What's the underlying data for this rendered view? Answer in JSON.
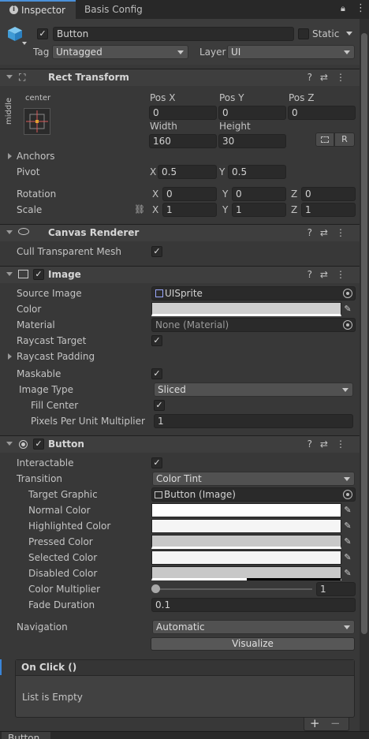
{
  "tabs": {
    "inspector": "Inspector",
    "basis_config": "Basis Config"
  },
  "object": {
    "name": "Button",
    "static_label": "Static",
    "tag_label": "Tag",
    "tag_value": "Untagged",
    "layer_label": "Layer",
    "layer_value": "UI"
  },
  "rect_transform": {
    "title": "Rect Transform",
    "anchor_h": "center",
    "anchor_v": "middle",
    "pos_x_label": "Pos X",
    "pos_y_label": "Pos Y",
    "pos_z_label": "Pos Z",
    "pos_x": "0",
    "pos_y": "0",
    "pos_z": "0",
    "width_label": "Width",
    "height_label": "Height",
    "width": "160",
    "height": "30",
    "r_button": "R",
    "anchors_label": "Anchors",
    "pivot_label": "Pivot",
    "pivot_x": "0.5",
    "pivot_y": "0.5",
    "rotation_label": "Rotation",
    "rot_x": "0",
    "rot_y": "0",
    "rot_z": "0",
    "scale_label": "Scale",
    "scale_x": "1",
    "scale_y": "1",
    "scale_z": "1",
    "axis_x": "X",
    "axis_y": "Y",
    "axis_z": "Z"
  },
  "canvas_renderer": {
    "title": "Canvas Renderer",
    "cull_label": "Cull Transparent Mesh"
  },
  "image": {
    "title": "Image",
    "source_image_label": "Source Image",
    "source_image": "UISprite",
    "color_label": "Color",
    "material_label": "Material",
    "material": "None (Material)",
    "raycast_target_label": "Raycast Target",
    "raycast_padding_label": "Raycast Padding",
    "maskable_label": "Maskable",
    "image_type_label": "Image Type",
    "image_type": "Sliced",
    "fill_center_label": "Fill Center",
    "ppu_label": "Pixels Per Unit Multiplier",
    "ppu": "1"
  },
  "button": {
    "title": "Button",
    "interactable_label": "Interactable",
    "transition_label": "Transition",
    "transition": "Color Tint",
    "target_graphic_label": "Target Graphic",
    "target_graphic": "Button (Image)",
    "normal_label": "Normal Color",
    "highlighted_label": "Highlighted Color",
    "pressed_label": "Pressed Color",
    "selected_label": "Selected Color",
    "disabled_label": "Disabled Color",
    "multiplier_label": "Color Multiplier",
    "multiplier": "1",
    "multiplier_fraction": 0.0,
    "fade_label": "Fade Duration",
    "fade": "0.1",
    "navigation_label": "Navigation",
    "navigation": "Automatic",
    "visualize": "Visualize"
  },
  "on_click": {
    "title": "On Click ()",
    "empty": "List is Empty",
    "add": "+",
    "remove": "−"
  },
  "footer": {
    "preview_title": "Button"
  },
  "colors": {
    "normal": "#ffffff",
    "highlighted": "#f5f5f5",
    "pressed": "#c8c8c8",
    "selected": "#f5f5f5",
    "disabled": "#c8c8c8",
    "image_color": "#ffffff"
  }
}
